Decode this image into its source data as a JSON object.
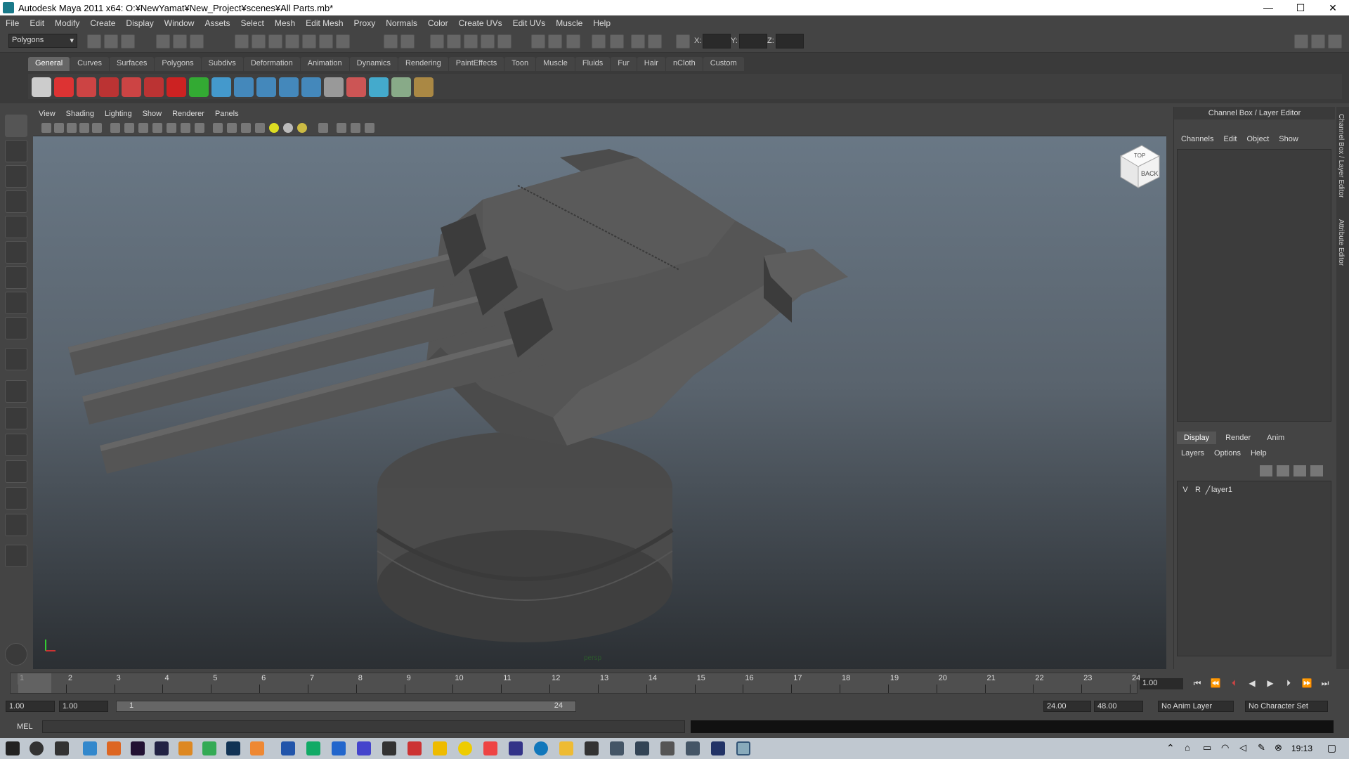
{
  "window": {
    "title": "Autodesk Maya 2011 x64: O:¥NewYamat¥New_Project¥scenes¥All Parts.mb*",
    "minimize": "—",
    "maximize": "☐",
    "close": "✕"
  },
  "menubar": [
    "File",
    "Edit",
    "Modify",
    "Create",
    "Display",
    "Window",
    "Assets",
    "Select",
    "Mesh",
    "Edit Mesh",
    "Proxy",
    "Normals",
    "Color",
    "Create UVs",
    "Edit UVs",
    "Muscle",
    "Help"
  ],
  "statusline": {
    "mode": "Polygons",
    "x_label": "X:",
    "y_label": "Y:",
    "z_label": "Z:"
  },
  "shelf": {
    "tabs": [
      "General",
      "Curves",
      "Surfaces",
      "Polygons",
      "Subdivs",
      "Deformation",
      "Animation",
      "Dynamics",
      "Rendering",
      "PaintEffects",
      "Toon",
      "Muscle",
      "Fluids",
      "Fur",
      "Hair",
      "nCloth",
      "Custom"
    ],
    "active": "General"
  },
  "viewport": {
    "menu": [
      "View",
      "Shading",
      "Lighting",
      "Show",
      "Renderer",
      "Panels"
    ],
    "camera": "persp",
    "viewcube": {
      "top": "TOP",
      "back": "BACK"
    }
  },
  "channel_box": {
    "title": "Channel Box / Layer Editor",
    "menu": [
      "Channels",
      "Edit",
      "Object",
      "Show"
    ],
    "layer_tabs": [
      "Display",
      "Render",
      "Anim"
    ],
    "active_layer_tab": "Display",
    "layer_menu": [
      "Layers",
      "Options",
      "Help"
    ],
    "layer": {
      "v": "V",
      "r": "R",
      "name": "layer1"
    },
    "side_tabs": [
      "Channel Box / Layer Editor",
      "Attribute Editor"
    ]
  },
  "timeline": {
    "ticks": [
      "1",
      "2",
      "3",
      "4",
      "5",
      "6",
      "7",
      "8",
      "9",
      "10",
      "11",
      "12",
      "13",
      "14",
      "15",
      "16",
      "17",
      "18",
      "19",
      "20",
      "21",
      "22",
      "23",
      "24"
    ],
    "current": "1",
    "current_field": "1.00"
  },
  "range": {
    "start": "1.00",
    "start2": "1.00",
    "inner_start": "1",
    "inner_end": "24",
    "end": "24.00",
    "end2": "48.00",
    "anim_layer": "No Anim Layer",
    "char_set": "No Character Set"
  },
  "cmd": {
    "label": "MEL"
  },
  "taskbar": {
    "clock": "19:13"
  }
}
